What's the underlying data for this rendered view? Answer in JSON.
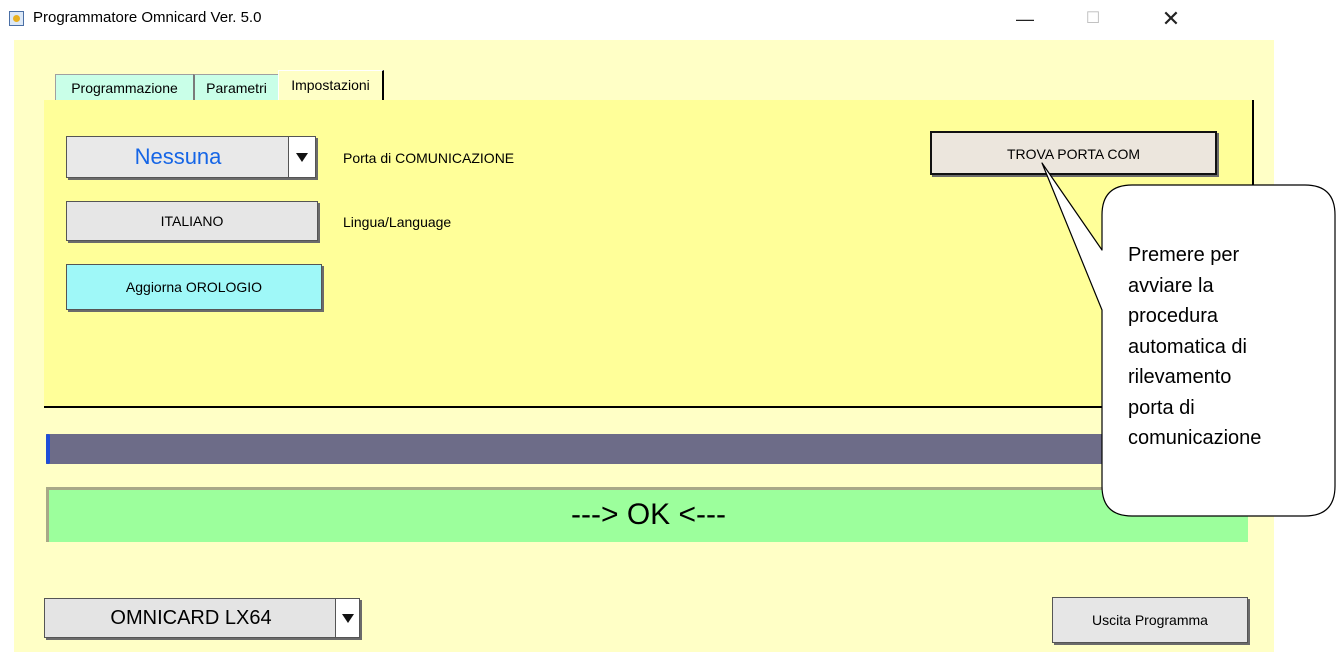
{
  "window": {
    "title": "Programmatore Omnicard Ver. 5.0",
    "minimize": "—",
    "maximize": "☐",
    "close": "✕"
  },
  "tabs": [
    {
      "label": "Programmazione"
    },
    {
      "label": "Parametri"
    },
    {
      "label": "Impostazioni"
    }
  ],
  "settings": {
    "com_port_value": "Nessuna",
    "com_port_label": "Porta di COMUNICAZIONE",
    "language_button": "ITALIANO",
    "language_label": "Lingua/Language",
    "clock_button": "Aggiorna OROLOGIO",
    "find_com_button": "TROVA PORTA COM"
  },
  "progress": {
    "value": 0.003
  },
  "status": {
    "text": "---> OK <---"
  },
  "footer": {
    "model_value": "OMNICARD LX64",
    "exit_button": "Uscita Programma"
  },
  "callout": {
    "lines": [
      "Premere per",
      "avviare la",
      "procedura",
      "automatica di",
      "rilevamento",
      "porta di",
      "comunicazione"
    ]
  },
  "colors": {
    "window_bg": "#ffffc6",
    "panel_bg": "#ffff99",
    "tab_inactive": "#c9ffe8",
    "com_value_text": "#1565e6",
    "clock_button_bg": "#9ff8f8",
    "progress_track": "#6d6c88",
    "progress_fill": "#1e4ed8",
    "status_bg": "#9cff9c"
  }
}
